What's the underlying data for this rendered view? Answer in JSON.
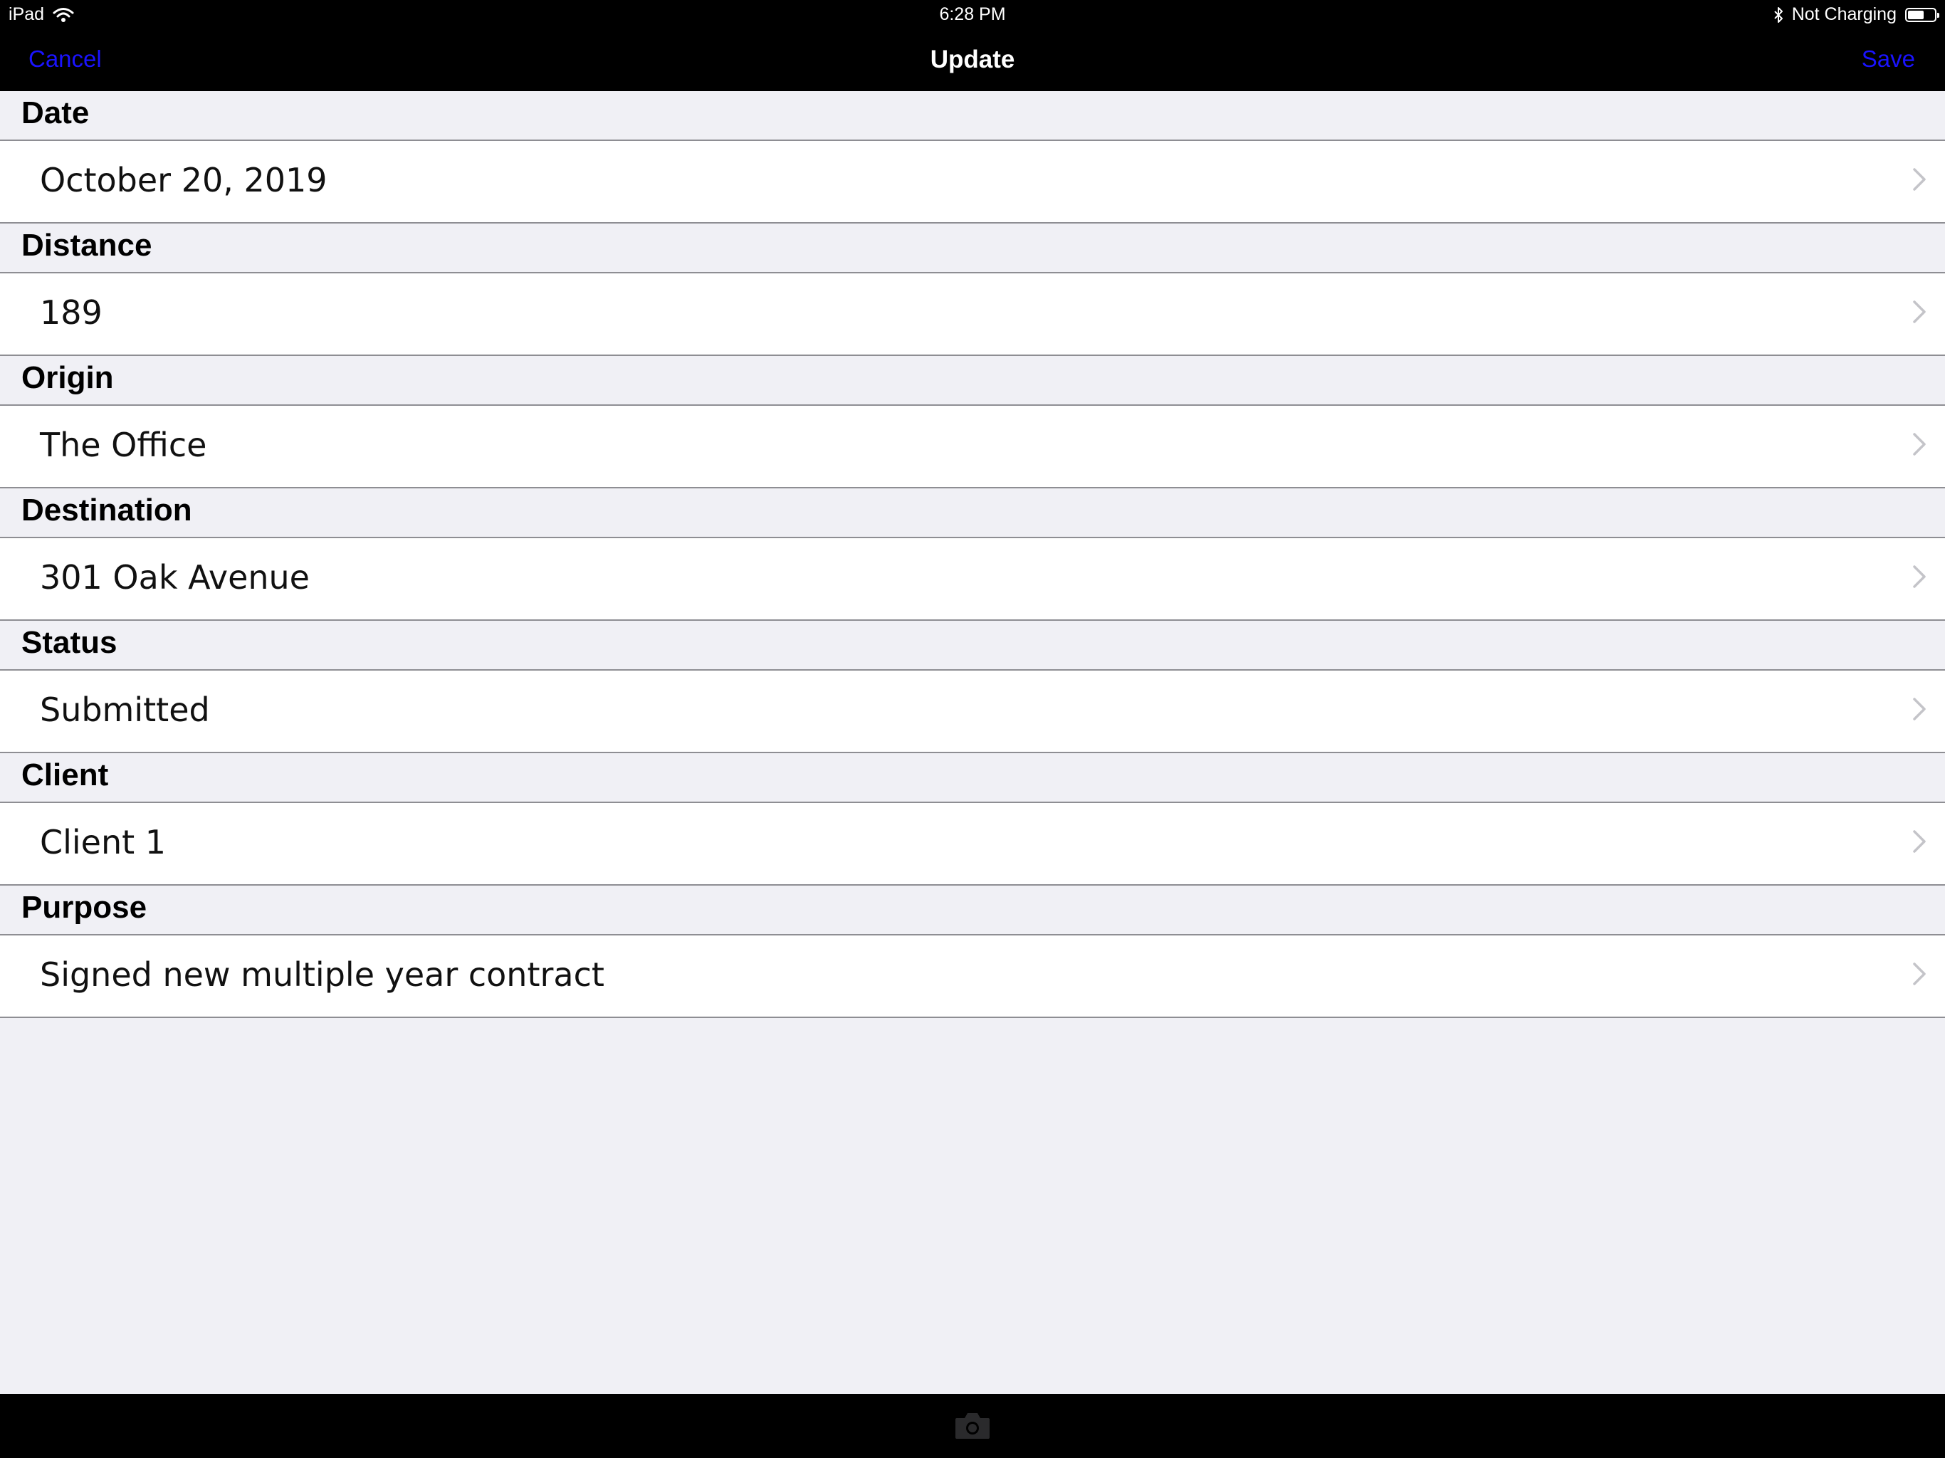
{
  "status_bar": {
    "device": "iPad",
    "time": "6:28 PM",
    "charging_status": "Not Charging",
    "battery_level": 0.62
  },
  "nav": {
    "cancel_label": "Cancel",
    "title": "Update",
    "save_label": "Save",
    "button_color": "#1a13ff"
  },
  "fields": [
    {
      "label": "Date",
      "value": "October 20, 2019"
    },
    {
      "label": "Distance",
      "value": "189"
    },
    {
      "label": "Origin",
      "value": "The Office"
    },
    {
      "label": "Destination",
      "value": "301 Oak Avenue"
    },
    {
      "label": "Status",
      "value": "Submitted"
    },
    {
      "label": "Client",
      "value": "Client 1"
    },
    {
      "label": "Purpose",
      "value": "Signed new multiple year contract"
    }
  ],
  "icons": {
    "wifi": "wifi-icon",
    "bluetooth": "bluetooth-icon",
    "battery": "battery-icon",
    "chevron": "chevron-right-icon",
    "camera": "camera-icon"
  }
}
